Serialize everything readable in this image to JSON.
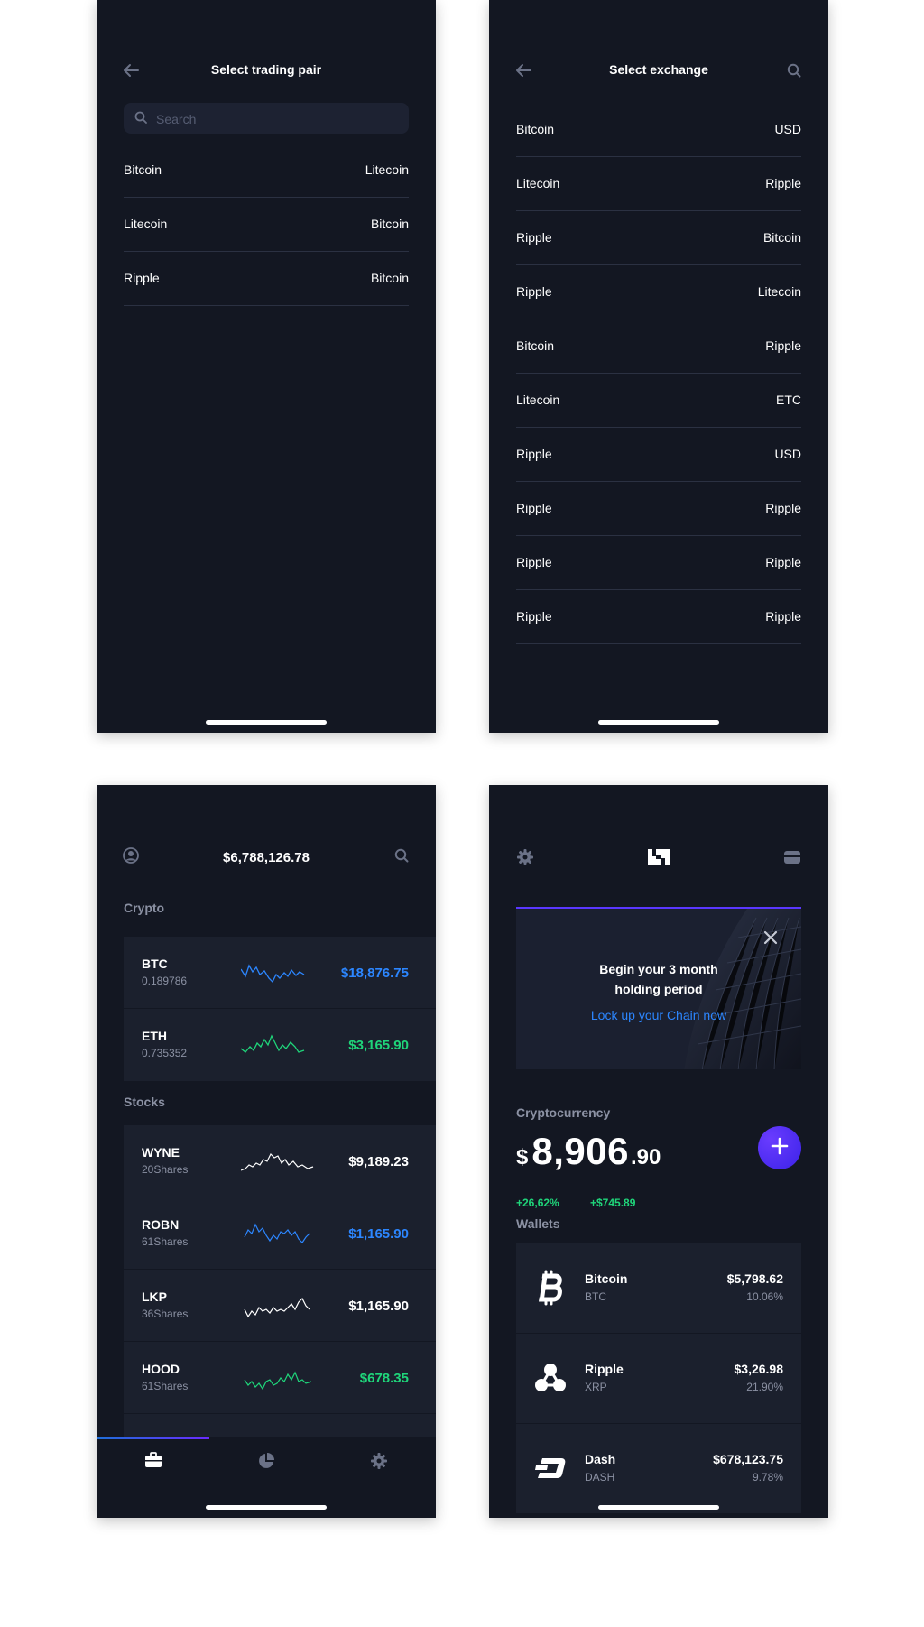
{
  "trading_pair_screen": {
    "title": "Select trading pair",
    "search_placeholder": "Search",
    "pairs": [
      {
        "left": "Bitcoin",
        "right": "Litecoin"
      },
      {
        "left": "Litecoin",
        "right": "Bitcoin"
      },
      {
        "left": "Ripple",
        "right": "Bitcoin"
      }
    ]
  },
  "exchange_screen": {
    "title": "Select exchange",
    "rows": [
      {
        "left": "Bitcoin",
        "right": "USD"
      },
      {
        "left": "Litecoin",
        "right": "Ripple"
      },
      {
        "left": "Ripple",
        "right": "Bitcoin"
      },
      {
        "left": "Ripple",
        "right": "Litecoin"
      },
      {
        "left": "Bitcoin",
        "right": "Ripple"
      },
      {
        "left": "Litecoin",
        "right": "ETC"
      },
      {
        "left": "Ripple",
        "right": "USD"
      },
      {
        "left": "Ripple",
        "right": "Ripple"
      },
      {
        "left": "Ripple",
        "right": "Ripple"
      },
      {
        "left": "Ripple",
        "right": "Ripple"
      }
    ]
  },
  "portfolio_screen": {
    "total": "$6,788,126.78",
    "crypto_label": "Crypto",
    "stocks_label": "Stocks",
    "crypto": [
      {
        "symbol": "BTC",
        "sub": "0.189786",
        "price": "$18,876.75",
        "color": "#2c86ff"
      },
      {
        "symbol": "ETH",
        "sub": "0.735352",
        "price": "$3,165.90",
        "color": "#1fd57a"
      }
    ],
    "stocks": [
      {
        "symbol": "WYNE",
        "sub": "20Shares",
        "price": "$9,189.23",
        "color": "#ffffff"
      },
      {
        "symbol": "ROBN",
        "sub": "61Shares",
        "price": "$1,165.90",
        "color": "#2c86ff"
      },
      {
        "symbol": "LKP",
        "sub": "36Shares",
        "price": "$1,165.90",
        "color": "#ffffff"
      },
      {
        "symbol": "HOOD",
        "sub": "61Shares",
        "price": "$678.35",
        "color": "#1fd57a"
      },
      {
        "symbol": "ROBN",
        "sub": "",
        "price": "",
        "color": "#2c86ff"
      }
    ],
    "tabs": [
      {
        "icon": "briefcase-icon",
        "active": true
      },
      {
        "icon": "pie-chart-icon",
        "active": false
      },
      {
        "icon": "gear-icon",
        "active": false
      }
    ]
  },
  "wallet_screen": {
    "banner": {
      "line1": "Begin your 3 month",
      "line2": "holding period",
      "link": "Lock up your Chain now"
    },
    "crypto_label": "Cryptocurrency",
    "balance_currency": "$",
    "balance_int": "8,906",
    "balance_dec": ".90",
    "change_pct": "+26,62%",
    "change_abs": "+$745.89",
    "wallets_label": "Wallets",
    "wallets": [
      {
        "name": "Bitcoin",
        "symbol": "BTC",
        "value": "$5,798.62",
        "pct": "10.06%",
        "icon": "bitcoin-icon"
      },
      {
        "name": "Ripple",
        "symbol": "XRP",
        "value": "$3,26.98",
        "pct": "21.90%",
        "icon": "ripple-icon"
      },
      {
        "name": "Dash",
        "symbol": "DASH",
        "value": "$678,123.75",
        "pct": "9.78%",
        "icon": "dash-icon"
      }
    ]
  },
  "colors": {
    "background": "#131722",
    "card": "#1b202d",
    "accent_blue": "#2c86ff",
    "accent_green": "#1fd57a",
    "accent_purple": "#5a37ff"
  }
}
